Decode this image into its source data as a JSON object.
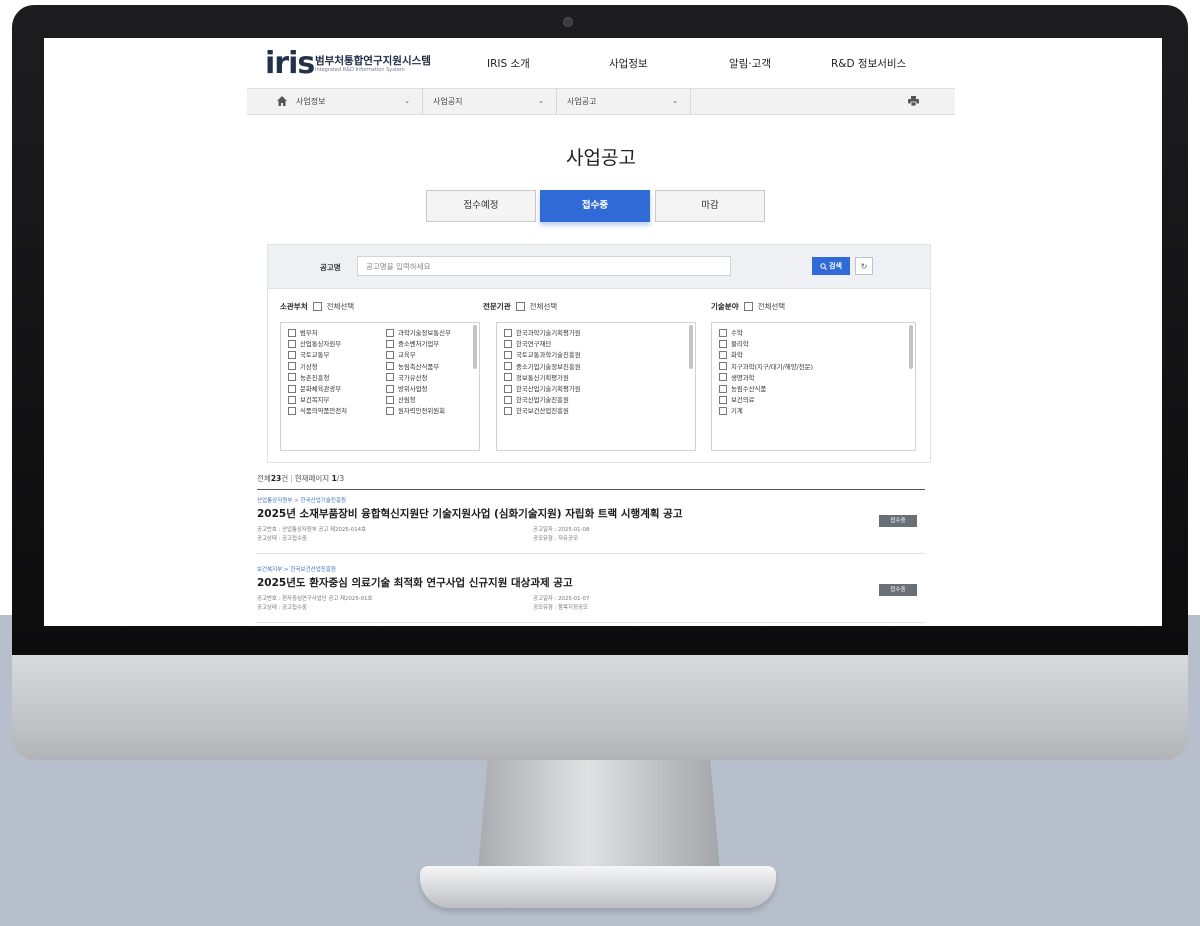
{
  "site": {
    "logo_text": "iris",
    "title": "범부처통합연구지원시스템",
    "subtitle": "Integrated R&D Information System"
  },
  "gnb": [
    "IRIS 소개",
    "사업정보",
    "알림·고객",
    "R&D 정보서비스"
  ],
  "breadcrumb": {
    "home_icon": "home-icon",
    "items": [
      "사업정보",
      "사업공지",
      "사업공고"
    ],
    "print_icon": "print-icon"
  },
  "page": {
    "title": "사업공고"
  },
  "tabs": [
    {
      "label": "접수예정",
      "active": false
    },
    {
      "label": "접수중",
      "active": true
    },
    {
      "label": "마감",
      "active": false
    }
  ],
  "search": {
    "label": "공고명",
    "placeholder": "공고명을 입력하세요",
    "value": "",
    "button_label": "검색",
    "reset_icon": "refresh-icon"
  },
  "filters": {
    "ministry": {
      "title": "소관부처",
      "all_label": "전체선택",
      "col1": [
        "범부처",
        "산업통상자원부",
        "국토교통부",
        "기상청",
        "농촌진흥청",
        "문화체육관광부",
        "보건복지부",
        "식품의약품안전처"
      ],
      "col2": [
        "과학기술정보통신부",
        "중소벤처기업부",
        "교육부",
        "농림축산식품부",
        "국가유산청",
        "방위사업청",
        "산림청",
        "원자력안전위원회"
      ]
    },
    "agency": {
      "title": "전문기관",
      "all_label": "전체선택",
      "items": [
        "한국과학기술기획평가원",
        "한국연구재단",
        "국토교통과학기술진흥원",
        "중소기업기술정보진흥원",
        "정보통신기획평가원",
        "한국산업기술기획평가원",
        "한국산업기술진흥원",
        "한국보건산업진흥원"
      ]
    },
    "field": {
      "title": "기술분야",
      "all_label": "전체선택",
      "items": [
        "수학",
        "물리학",
        "화학",
        "지구과학(지구/대기/해양/천문)",
        "생명과학",
        "농림수산식품",
        "보건의료",
        "기계"
      ]
    }
  },
  "results": {
    "total_label": "전체",
    "total": "23",
    "total_unit": "건",
    "page_label": "현재페이지",
    "current_page": "1",
    "page_sep": "/",
    "total_pages": "3"
  },
  "notices": [
    {
      "dept": "산업통상자원부 > 한국산업기술진흥원",
      "title": "2025년 소재부품장비 융합혁신지원단 기술지원사업 (심화기술지원) 자립화 트랙 시행계획 공고",
      "no_label": "공고번호 :",
      "no": "산업통상자원부 공고 제2025-014호",
      "status_label": "공고상태 :",
      "status": "공고접수중",
      "date_label": "공고일자 :",
      "date": "2025-01-08",
      "type_label": "공모유형 :",
      "type": "자유공모",
      "badge": "접수중"
    },
    {
      "dept": "보건복지부 > 한국보건산업진흥원",
      "title": "2025년도 환자중심 의료기술 최적화 연구사업 신규지원 대상과제 공고",
      "no_label": "공고번호 :",
      "no": "환자중심연구사업단 공고 제2025-01호",
      "status_label": "공고상태 :",
      "status": "공고접수중",
      "date_label": "공고일자 :",
      "date": "2025-01-07",
      "type_label": "공모유형 :",
      "type": "품목지정공모",
      "badge": "접수중"
    }
  ],
  "colors": {
    "accent": "#2f6ad6",
    "badge": "#6b6f76",
    "logo_dark": "#22324d",
    "logo_blue": "#3a7bd5"
  }
}
